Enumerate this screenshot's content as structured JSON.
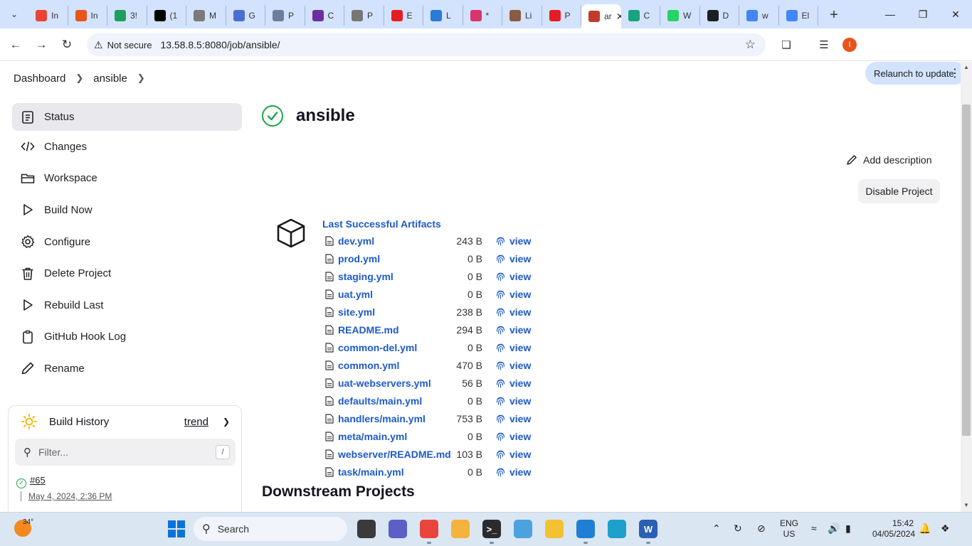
{
  "browser": {
    "tabs": [
      {
        "label": "In",
        "icon": "gmail-icon",
        "color": "#ea4335"
      },
      {
        "label": "In",
        "icon": "orange-app-icon",
        "color": "#e8541c"
      },
      {
        "label": "3!",
        "icon": "grid-app-icon",
        "color": "#1e9e5a"
      },
      {
        "label": "(1",
        "icon": "x-icon",
        "color": "#000000"
      },
      {
        "label": "M",
        "icon": "medium-icon",
        "color": "#7a7a7a"
      },
      {
        "label": "G",
        "icon": "docs-icon",
        "color": "#4a6fd1"
      },
      {
        "label": "P",
        "icon": "wordpress-icon",
        "color": "#6a7fa0"
      },
      {
        "label": "C",
        "icon": "course-icon",
        "color": "#6b2fa0"
      },
      {
        "label": "P",
        "icon": "circle-app-icon",
        "color": "#777777"
      },
      {
        "label": "E",
        "icon": "youtube-icon",
        "color": "#e61c24"
      },
      {
        "label": "L",
        "icon": "leetcode-icon",
        "color": "#2a7ad8"
      },
      {
        "label": "*",
        "icon": "slack-icon",
        "color": "#d8356a"
      },
      {
        "label": "Li",
        "icon": "avatar-icon",
        "color": "#8a5a44"
      },
      {
        "label": "P",
        "icon": "youtube-icon",
        "color": "#e61c24"
      },
      {
        "label": "ar",
        "icon": "jenkins-icon",
        "color": "#c03b2b",
        "active": true
      },
      {
        "label": "C",
        "icon": "chatgpt-icon",
        "color": "#19a37f"
      },
      {
        "label": "W",
        "icon": "whatsapp-icon",
        "color": "#25d366"
      },
      {
        "label": "D",
        "icon": "github-icon",
        "color": "#1b1f23"
      },
      {
        "label": "w",
        "icon": "google-icon",
        "color": "#4285f4"
      },
      {
        "label": "El",
        "icon": "google-icon",
        "color": "#4285f4"
      }
    ],
    "not_secure": "Not secure",
    "url": "13.58.8.5:8080/job/ansible/",
    "profile_initial": "I",
    "relaunch": "Relaunch to update"
  },
  "breadcrumb": {
    "root": "Dashboard",
    "job": "ansible"
  },
  "sidebar": {
    "items": [
      {
        "label": "Status",
        "icon": "notepad-icon"
      },
      {
        "label": "Changes",
        "icon": "code-icon"
      },
      {
        "label": "Workspace",
        "icon": "folder-icon"
      },
      {
        "label": "Build Now",
        "icon": "play-icon"
      },
      {
        "label": "Configure",
        "icon": "gear-icon"
      },
      {
        "label": "Delete Project",
        "icon": "trash-icon"
      },
      {
        "label": "Rebuild Last",
        "icon": "play-icon"
      },
      {
        "label": "GitHub Hook Log",
        "icon": "clipboard-icon"
      },
      {
        "label": "Rename",
        "icon": "pencil-icon"
      }
    ]
  },
  "build_history": {
    "title": "Build History",
    "trend": "trend",
    "filter_placeholder": "Filter...",
    "shortcut": "/",
    "builds": [
      {
        "number": "#65",
        "date": "May 4, 2024, 2:36 PM"
      }
    ]
  },
  "main": {
    "title": "ansible",
    "add_description": "Add description",
    "disable_project": "Disable Project",
    "artifacts_title": "Last Successful Artifacts",
    "view_label": "view",
    "artifacts": [
      {
        "name": "dev.yml",
        "size": "243 B"
      },
      {
        "name": "prod.yml",
        "size": "0 B"
      },
      {
        "name": "staging.yml",
        "size": "0 B"
      },
      {
        "name": "uat.yml",
        "size": "0 B"
      },
      {
        "name": "site.yml",
        "size": "238 B"
      },
      {
        "name": "README.md",
        "size": "294 B"
      },
      {
        "name": "common-del.yml",
        "size": "0 B"
      },
      {
        "name": "common.yml",
        "size": "470 B"
      },
      {
        "name": "uat-webservers.yml",
        "size": "56 B"
      },
      {
        "name": "defaults/main.yml",
        "size": "0 B"
      },
      {
        "name": "handlers/main.yml",
        "size": "753 B"
      },
      {
        "name": "meta/main.yml",
        "size": "0 B"
      },
      {
        "name": "webserver/README.md",
        "size": "103 B"
      },
      {
        "name": "task/main.yml",
        "size": "0 B"
      }
    ],
    "downstream_title": "Downstream Projects"
  },
  "taskbar": {
    "temperature": "34°",
    "search": "Search",
    "lang1": "ENG",
    "lang2": "US",
    "time": "15:42",
    "date": "04/05/2024"
  },
  "colors": {
    "link": "#1d5ac9",
    "success": "#1ea446",
    "tabstrip": "#d3e3fd"
  }
}
